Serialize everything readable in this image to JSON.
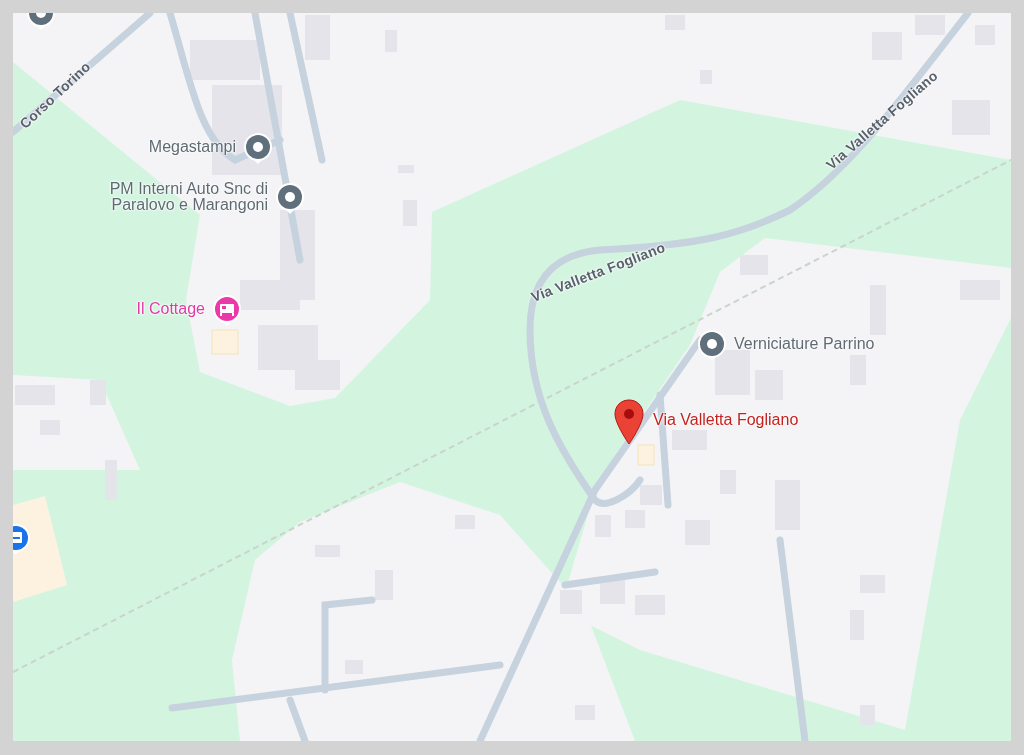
{
  "map": {
    "road_labels": [
      {
        "text": "Corso Torino"
      },
      {
        "text": "Via Valletta Fogliano"
      },
      {
        "text": "Via Valletta Fogliano"
      }
    ],
    "places": [
      {
        "kind": "poi"
      },
      {
        "kind": "poi",
        "label": "Megastampi"
      },
      {
        "kind": "poi",
        "label": "PM Interni Auto Snc di Paralovo e Marangoni"
      },
      {
        "kind": "hotel",
        "label": "Il Cottage"
      },
      {
        "kind": "poi",
        "label": "Verniciature Parrino"
      },
      {
        "kind": "selected",
        "label": "Via Valletta Fogliano"
      },
      {
        "kind": "shop"
      }
    ]
  }
}
